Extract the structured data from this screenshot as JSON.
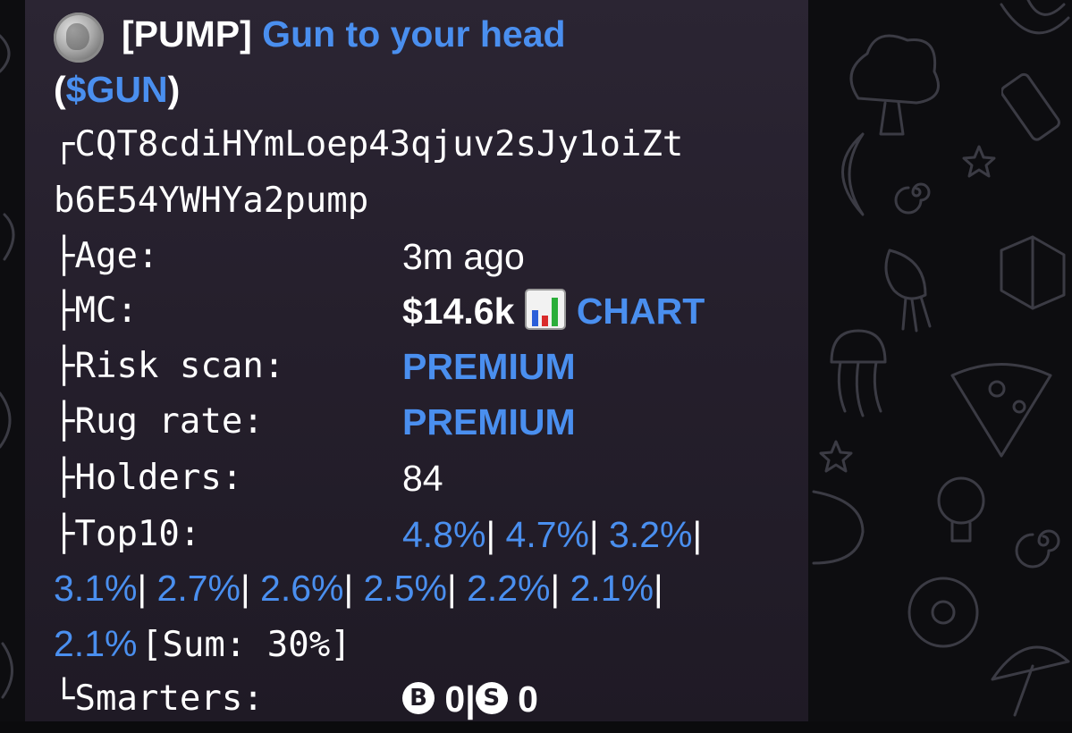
{
  "token": {
    "exchange_tag": "[PUMP]",
    "name": "Gun to your head",
    "ticker": "$GUN",
    "address_line1": "CQT8cdiHYmLoep43qjuv2sJy1oiZt",
    "address_line2": "b6E54YWHYa2pump"
  },
  "fields": {
    "age": {
      "label": "Age:",
      "value": "3m ago"
    },
    "mc": {
      "label": "MC:",
      "value": "$14.6k",
      "chart_link": "CHART"
    },
    "risk_scan": {
      "label": "Risk scan:",
      "value": "PREMIUM"
    },
    "rug_rate": {
      "label": "Rug rate:",
      "value": "PREMIUM"
    },
    "holders": {
      "label": "Holders:",
      "value": "84"
    },
    "top10": {
      "label": "Top10:",
      "percentages": [
        "4.8%",
        "4.7%",
        "3.2%",
        "3.1%",
        "2.7%",
        "2.6%",
        "2.5%",
        "2.2%",
        "2.1%",
        "2.1%"
      ],
      "separator": "|",
      "sum_text": "[Sum: 30%]"
    },
    "smarters": {
      "label": "Smarters:",
      "buy_icon": "B",
      "buy_count": "0",
      "sell_icon": "S",
      "sell_count": "0"
    }
  },
  "tree": {
    "first": "┌",
    "mid": "├",
    "last": "└"
  },
  "icons": {
    "coin": "token-coin-icon",
    "chart": "bar-chart-icon",
    "buy": "circled-b-icon",
    "sell": "circled-s-icon"
  },
  "colors": {
    "bubble": "#2b2533",
    "link": "#4a8fef",
    "text": "#ffffff",
    "wallpaper": "#0d0d10"
  }
}
